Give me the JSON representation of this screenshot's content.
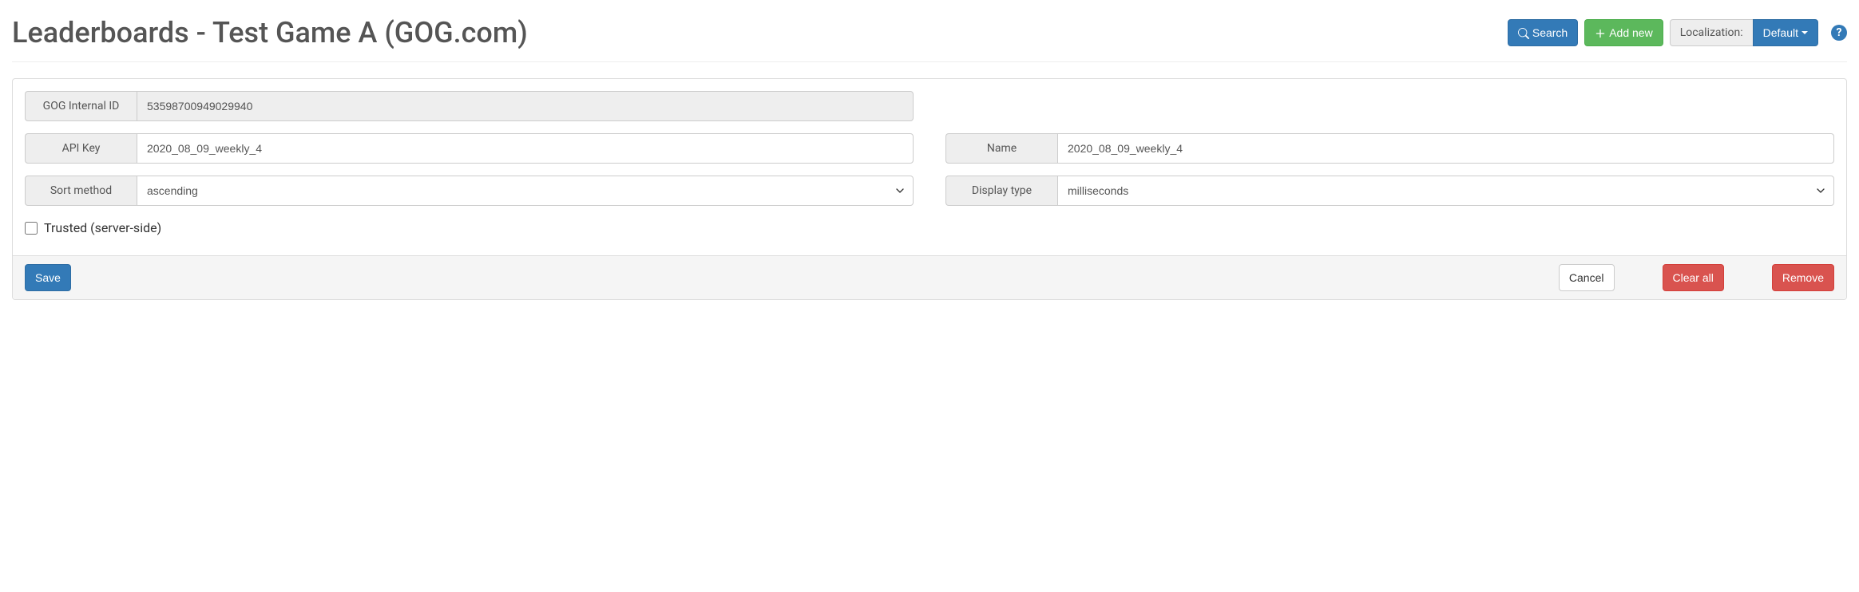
{
  "header": {
    "title": "Leaderboards - Test Game A (GOG.com)",
    "search_label": "Search",
    "add_new_label": "Add new",
    "localization_label": "Localization:",
    "localization_value": "Default"
  },
  "form": {
    "gog_internal_id": {
      "label": "GOG Internal ID",
      "value": "53598700949029940"
    },
    "api_key": {
      "label": "API Key",
      "value": "2020_08_09_weekly_4"
    },
    "name": {
      "label": "Name",
      "value": "2020_08_09_weekly_4"
    },
    "sort_method": {
      "label": "Sort method",
      "value": "ascending"
    },
    "display_type": {
      "label": "Display type",
      "value": "milliseconds"
    },
    "trusted": {
      "label": "Trusted (server-side)",
      "checked": false
    }
  },
  "footer": {
    "save_label": "Save",
    "cancel_label": "Cancel",
    "clear_all_label": "Clear all",
    "remove_label": "Remove"
  }
}
